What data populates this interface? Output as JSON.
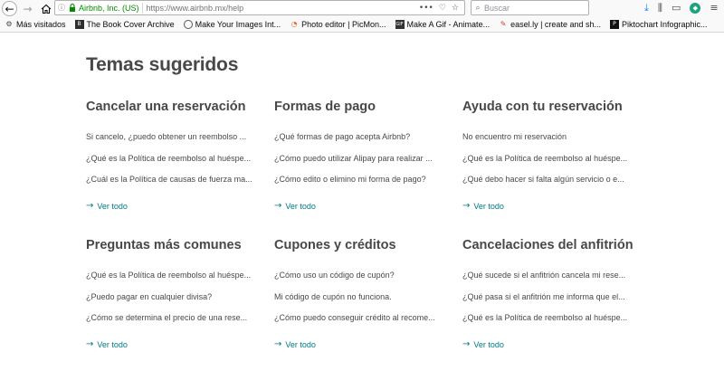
{
  "browser": {
    "back_glyph": "←",
    "forward_glyph": "→",
    "site_identity": "Airbnb, Inc. (US)",
    "url": "https://www.airbnb.mx/help",
    "url_actions": [
      "•••",
      "♡",
      "☆"
    ],
    "search_placeholder": "Buscar",
    "icons": [
      "download-icon",
      "library-icon",
      "sidebar-icon",
      "extension-icon",
      "menu-icon"
    ]
  },
  "bookmarks": [
    {
      "label": "Más visitados",
      "icon": "gear-icon"
    },
    {
      "label": "The Book Cover Archive",
      "icon": "book-icon"
    },
    {
      "label": "Make Your Images Int...",
      "icon": "globe-icon"
    },
    {
      "label": "Photo editor | PicMon...",
      "icon": "picmonkey-icon"
    },
    {
      "label": "Make A Gif - Animate...",
      "icon": "gif-icon"
    },
    {
      "label": "easel.ly | create and sh...",
      "icon": "easel-icon"
    },
    {
      "label": "Piktochart Infographic...",
      "icon": "piktochart-icon"
    }
  ],
  "page": {
    "title": "Temas sugeridos",
    "see_all_label": "Ver todo",
    "link_color": "#007a87",
    "text_color": "#484848",
    "sections": [
      {
        "title": "Cancelar una reservación",
        "questions": [
          "Si cancelo, ¿puedo obtener un reembolso ...",
          "¿Qué es la Política de reembolso al huéspe...",
          "¿Cuál es la Política de causas de fuerza ma..."
        ]
      },
      {
        "title": "Formas de pago",
        "questions": [
          "¿Qué formas de pago acepta Airbnb?",
          "¿Cómo puedo utilizar Alipay para realizar ...",
          "¿Cómo edito o elimino mi forma de pago?"
        ]
      },
      {
        "title": "Ayuda con tu reservación",
        "questions": [
          "No encuentro mi reservación",
          "¿Qué es la Política de reembolso al huéspe...",
          "¿Qué debo hacer si falta algún servicio o e..."
        ]
      },
      {
        "title": "Preguntas más comunes",
        "questions": [
          "¿Qué es la Política de reembolso al huéspe...",
          "¿Puedo pagar en cualquier divisa?",
          "¿Cómo se determina el precio de una rese..."
        ]
      },
      {
        "title": "Cupones y créditos",
        "questions": [
          "¿Cómo uso un código de cupón?",
          "Mi código de cupón no funciona.",
          "¿Cómo puedo conseguir crédito al recome..."
        ]
      },
      {
        "title": "Cancelaciones del anfitrión",
        "questions": [
          "¿Qué sucede si el anfitrión cancela mi rese...",
          "¿Qué pasa si el anfitrión me informa que el...",
          "¿Qué es la Política de reembolso al huéspe..."
        ]
      }
    ]
  }
}
